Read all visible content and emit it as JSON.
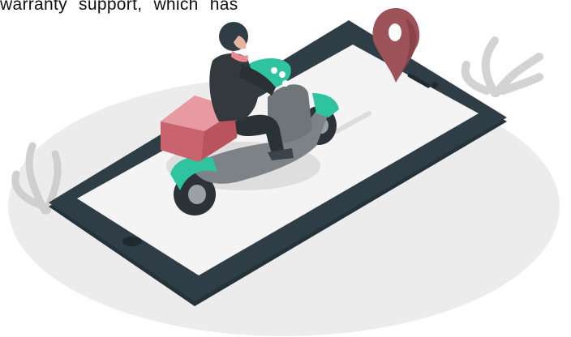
{
  "caption": {
    "text": "warranty support, which has"
  },
  "colors": {
    "phone_body": "#2f3e46",
    "phone_screen": "#f4f4f4",
    "pin": "#9e525a",
    "scooter_teal": "#2ec4a0",
    "box_pink": "#d97c86",
    "rider_dark": "#33393d",
    "plant": "#d9d9d9",
    "ground_ellipse": "#ececec"
  },
  "icons": [
    "location-pin-icon",
    "delivery-scooter-illustration",
    "smartphone-illustration",
    "plant-leaf-icon"
  ]
}
